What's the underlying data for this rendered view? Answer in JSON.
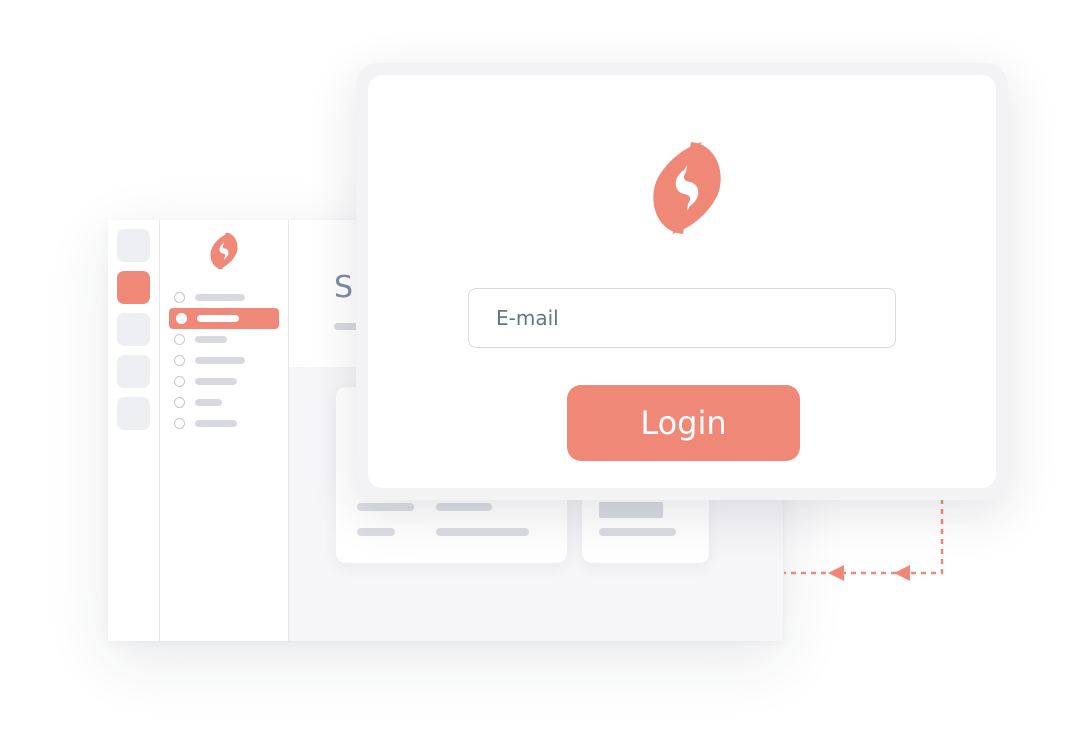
{
  "colors": {
    "accent": "#f08878",
    "skeleton": "#dcdee3",
    "text_muted": "#66728a"
  },
  "app_window": {
    "page_title": "SI"
  },
  "login_modal": {
    "email": {
      "placeholder": "E-mail",
      "value": ""
    },
    "login_label": "Login"
  }
}
